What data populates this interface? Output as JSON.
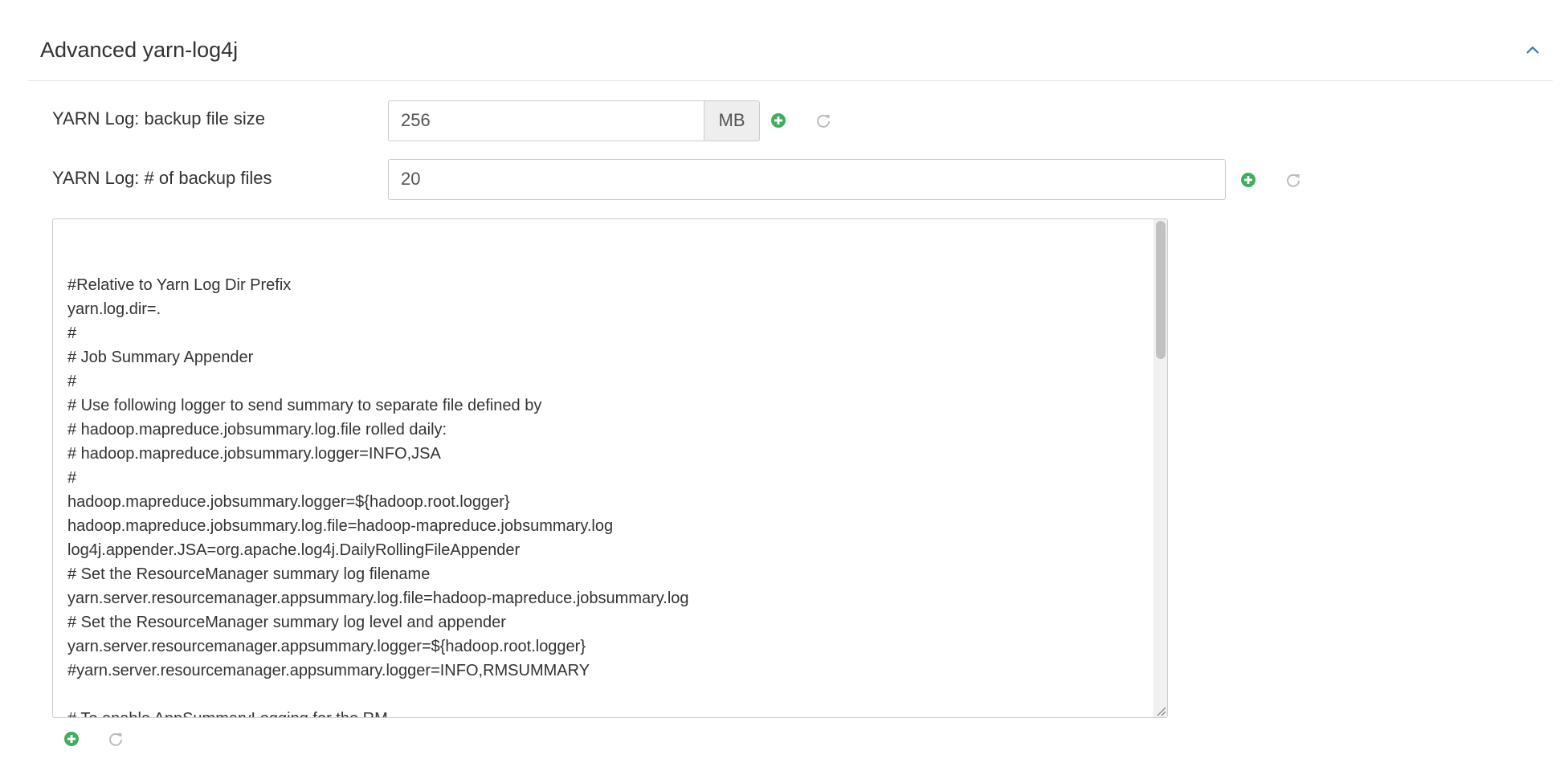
{
  "section": {
    "title": "Advanced yarn-log4j",
    "collapse_icon": "chevron-up-icon"
  },
  "colors": {
    "add_icon": "#3fae5e",
    "undo_icon": "#bbbbbb",
    "accent": "#337ab7"
  },
  "fields": [
    {
      "label": "YARN Log: backup file size",
      "value": "256",
      "unit": "MB",
      "add_icon": "plus-circle-icon",
      "undo_icon": "undo-icon"
    },
    {
      "label": "YARN Log: # of backup files",
      "value": "20",
      "add_icon": "plus-circle-icon",
      "undo_icon": "undo-icon"
    }
  ],
  "content_editor": {
    "lines": [
      "",
      "#Relative to Yarn Log Dir Prefix",
      "yarn.log.dir=.",
      "#",
      "# Job Summary Appender",
      "#",
      "# Use following logger to send summary to separate file defined by",
      "# hadoop.mapreduce.jobsummary.log.file rolled daily:",
      "# hadoop.mapreduce.jobsummary.logger=INFO,JSA",
      "#",
      "hadoop.mapreduce.jobsummary.logger=${hadoop.root.logger}",
      "hadoop.mapreduce.jobsummary.log.file=hadoop-mapreduce.jobsummary.log",
      "log4j.appender.JSA=org.apache.log4j.DailyRollingFileAppender",
      "# Set the ResourceManager summary log filename",
      "yarn.server.resourcemanager.appsummary.log.file=hadoop-mapreduce.jobsummary.log",
      "# Set the ResourceManager summary log level and appender",
      "yarn.server.resourcemanager.appsummary.logger=${hadoop.root.logger}",
      "#yarn.server.resourcemanager.appsummary.logger=INFO,RMSUMMARY",
      "",
      "# To enable AppSummaryLogging for the RM,"
    ],
    "add_icon": "plus-circle-icon",
    "undo_icon": "undo-icon"
  }
}
